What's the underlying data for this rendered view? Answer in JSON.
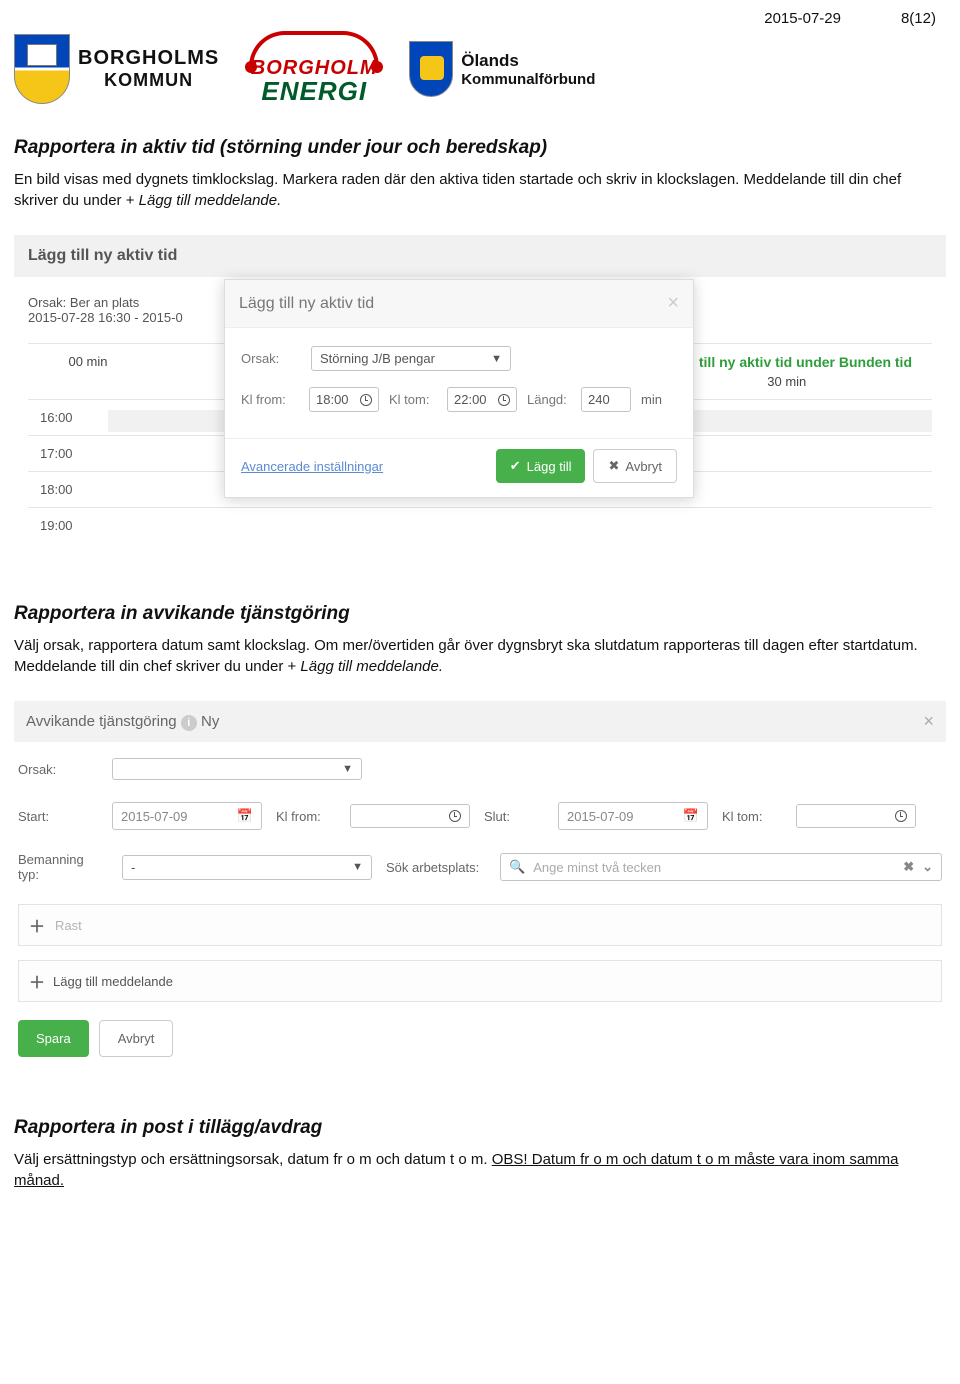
{
  "header": {
    "date": "2015-07-29",
    "page": "8(12)",
    "borgholms_top": "BORGHOLMS",
    "borgholms_bottom": "KOMMUN",
    "energi_top": "BORGHOLM",
    "energi_bottom": "ENERGI",
    "olands_top": "Ölands",
    "olands_bottom": "Kommunalförbund"
  },
  "section1": {
    "heading": "Rapportera in aktiv tid (störning under jour och beredskap)",
    "para_lead": "En bild visas med dygnets timklockslag. Markera raden där den aktiva tiden startade och skriv in klockslagen. Meddelande till din chef skriver du under + ",
    "para_em": "Lägg till meddelande."
  },
  "shot1": {
    "panel_header": "Lägg till ny aktiv tid",
    "orsak_prefix": "Orsak: ",
    "orsak_value": "Ber an plats",
    "daterange": "2015-07-28 16:30 - 2015-0",
    "col_left": "00 min",
    "col_right_green": "Lägg till ny aktiv tid under Bunden tid",
    "col_right_val": "30 min",
    "times": [
      "16:00",
      "17:00",
      "18:00",
      "19:00"
    ],
    "modal": {
      "title": "Lägg till ny aktiv tid",
      "orsak_label": "Orsak:",
      "orsak_value": "Störning J/B pengar",
      "kl_from_label": "Kl from:",
      "kl_from_value": "18:00",
      "kl_tom_label": "Kl tom:",
      "kl_tom_value": "22:00",
      "langd_label": "Längd:",
      "langd_value": "240",
      "langd_unit": "min",
      "adv": "Avancerade inställningar",
      "add": "Lägg till",
      "cancel": "Avbryt"
    }
  },
  "section2": {
    "heading": "Rapportera in avvikande tjänstgöring",
    "para_lead": "Välj orsak, rapportera datum samt klockslag. Om mer/övertiden går över dygnsbryt ska slutdatum rapporteras till dagen efter startdatum. Meddelande till din chef skriver du under + ",
    "para_em": "Lägg till meddelande."
  },
  "shot2": {
    "header": "Avvikande tjänstgöring",
    "ny": "Ny",
    "orsak_label": "Orsak:",
    "start_label": "Start:",
    "start_value": "2015-07-09",
    "klfrom_label": "Kl from:",
    "slut_label": "Slut:",
    "slut_value": "2015-07-09",
    "kltom_label": "Kl tom:",
    "bemanning_label": "Bemanning typ:",
    "bemanning_value": "-",
    "sok_label": "Sök arbetsplats:",
    "sok_placeholder": "Ange minst två tecken",
    "rast": "Rast",
    "meddelande": "Lägg till meddelande",
    "spara": "Spara",
    "avbryt": "Avbryt"
  },
  "section3": {
    "heading": "Rapportera in post i tillägg/avdrag",
    "para_lead": "Välj ersättningstyp och ersättningsorsak, datum fr o m och datum t o m. ",
    "obs": "OBS! Datum fr o m och datum t o m måste vara inom samma månad."
  }
}
